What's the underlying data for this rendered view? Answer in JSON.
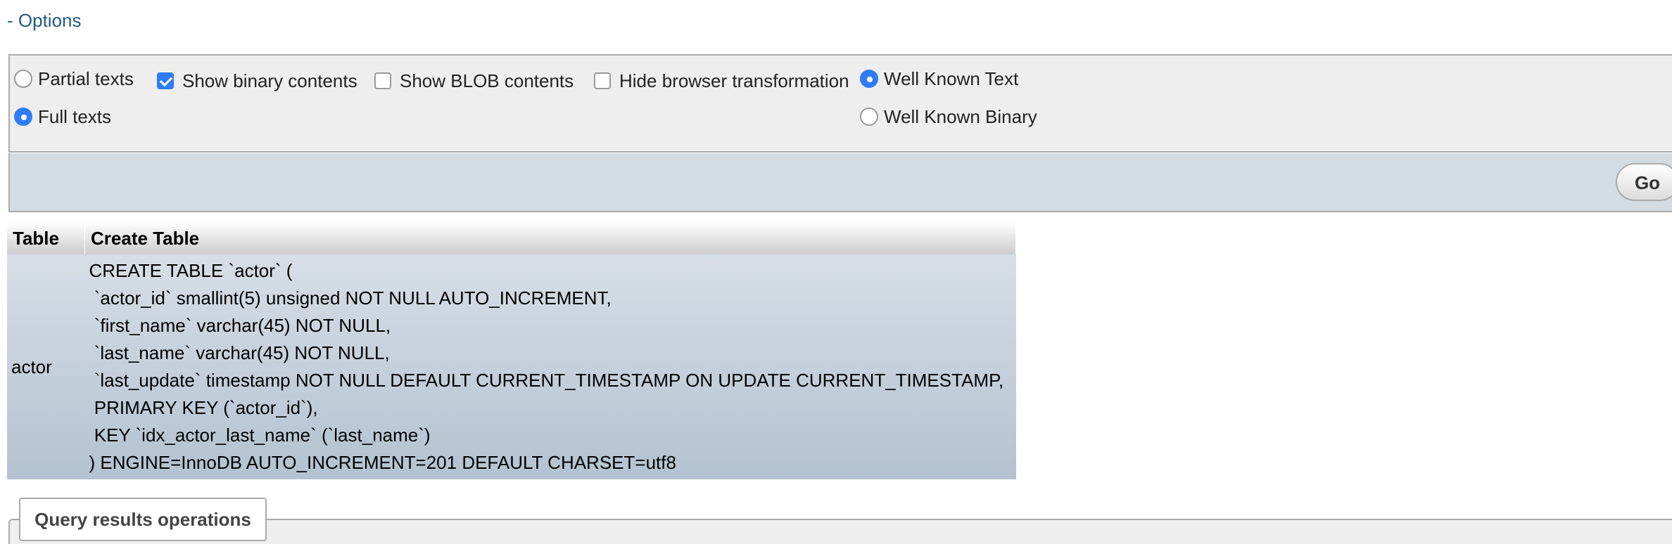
{
  "options": {
    "toggle_label": "- Options",
    "partial_texts": "Partial texts",
    "full_texts": "Full texts",
    "show_binary": "Show binary contents",
    "show_blob": "Show BLOB contents",
    "hide_transformation": "Hide browser transformation",
    "well_known_text": "Well Known Text",
    "well_known_binary": "Well Known Binary",
    "text_mode": "Full texts",
    "geometry_mode": "Well Known Text",
    "show_binary_checked": true,
    "show_blob_checked": false,
    "hide_transformation_checked": false
  },
  "go_label": "Go",
  "result": {
    "headers": [
      "Table",
      "Create Table"
    ],
    "table_name": "actor",
    "create_sql_lines": [
      "CREATE TABLE `actor` (",
      " `actor_id` smallint(5) unsigned NOT NULL AUTO_INCREMENT,",
      " `first_name` varchar(45) NOT NULL,",
      " `last_name` varchar(45) NOT NULL,",
      " `last_update` timestamp NOT NULL DEFAULT CURRENT_TIMESTAMP ON UPDATE CURRENT_TIMESTAMP,",
      " PRIMARY KEY (`actor_id`),",
      " KEY `idx_actor_last_name` (`last_name`)",
      ") ENGINE=InnoDB AUTO_INCREMENT=201 DEFAULT CHARSET=utf8"
    ]
  },
  "query_results_operations": "Query results operations",
  "colors": {
    "link": "#235a81",
    "radio_checked": "#2f7cf6",
    "fieldset_bg": "#eeeeee",
    "footer_bg": "#d3dce3"
  }
}
